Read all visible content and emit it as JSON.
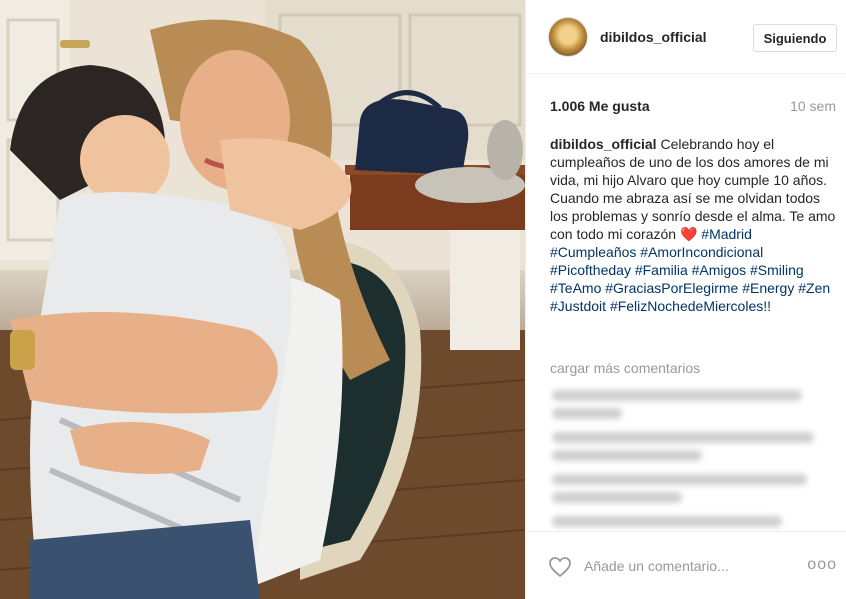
{
  "post": {
    "image_alt": "Mother hugging her son"
  },
  "header": {
    "username": "dibildos_official",
    "follow_label": "Siguiendo"
  },
  "stats": {
    "likes": "1.006 Me gusta",
    "time": "10 sem"
  },
  "caption": {
    "username": "dibildos_official",
    "text": "Celebrando hoy el cumpleaños de uno de los dos amores de mi vida, mi hijo Alvaro que hoy cumple 10 años. Cuando me abraza así se me olvidan todos los problemas y sonrío desde el alma. Te amo con todo mi corazón ❤️",
    "hashtags": [
      "#Madrid",
      "#Cumpleaños",
      "#AmorIncondicional",
      "#Picoftheday",
      "#Familia",
      "#Amigos",
      "#Smiling",
      "#TeAmo",
      "#GraciasPorElegirme",
      "#Energy",
      "#Zen",
      "#Justdoit",
      "#FelizNochedeMiercoles!!"
    ]
  },
  "comments": {
    "load_more": "cargar más comentarios"
  },
  "footer": {
    "comment_placeholder": "Añade un comentario...",
    "more_label": "ooo",
    "icons": {
      "like": "heart-outline-icon",
      "more": "more-options-icon"
    }
  },
  "colors": {
    "hashtag": "#003569",
    "muted": "#999999",
    "border": "#efefef"
  }
}
